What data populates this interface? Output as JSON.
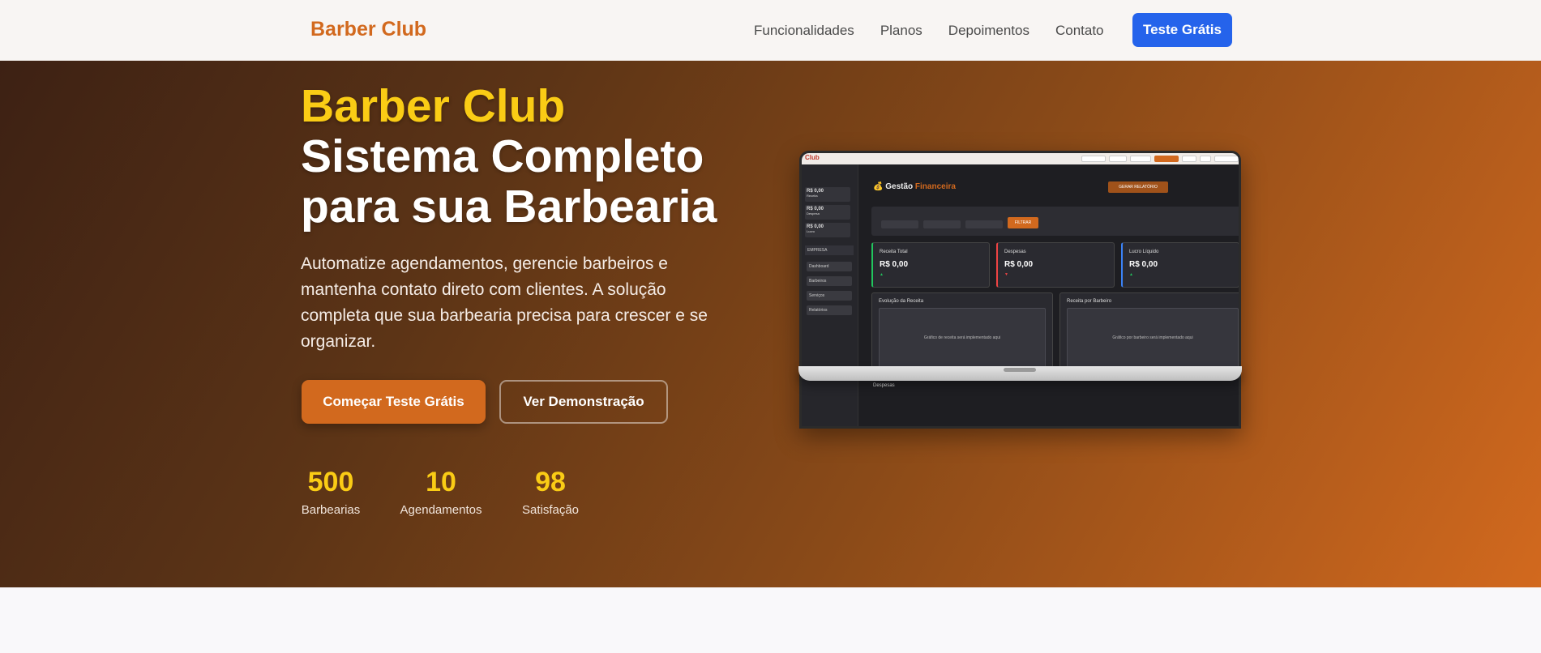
{
  "navbar": {
    "brand": "Barber Club",
    "links": [
      "Funcionalidades",
      "Planos",
      "Depoimentos",
      "Contato"
    ],
    "cta": "Teste Grátis"
  },
  "hero": {
    "title_line1": "Barber Club",
    "title_line2": "Sistema Completo para sua Barbearia",
    "description": "Automatize agendamentos, gerencie barbeiros e mantenha contato direto com clientes. A solução completa que sua barbearia precisa para crescer e se organizar.",
    "primary_button": "Começar Teste Grátis",
    "secondary_button": "Ver Demonstração",
    "stats": [
      {
        "value": "500",
        "label": "Barbearias"
      },
      {
        "value": "10",
        "label": "Agendamentos"
      },
      {
        "value": "98",
        "label": "Satisfação"
      }
    ]
  },
  "mockup": {
    "logo": "Club",
    "page_title_icon": "💰",
    "page_title_plain": "Gestão",
    "page_title_accent": "Financeira",
    "report_button": "GERAR RELATÓRIO",
    "filter_button": "FILTRAR",
    "sidebar_cards": [
      {
        "value": "R$ 0,00",
        "label": "Receita"
      },
      {
        "value": "R$ 0,00",
        "label": "Despesa"
      },
      {
        "value": "R$ 0,00",
        "label": "Lucro"
      }
    ],
    "sidebar_section": "EMPRESA",
    "sidebar_menu": [
      "Dashboard",
      "Barbeiros",
      "Serviços",
      "Relatórios"
    ],
    "kpis": [
      {
        "title": "Receita Total",
        "value": "R$ 0,00",
        "color": "#22c55e"
      },
      {
        "title": "Despesas",
        "value": "R$ 0,00",
        "color": "#ef4444"
      },
      {
        "title": "Lucro Líquido",
        "value": "R$ 0,00",
        "color": "#3b82f6"
      }
    ],
    "panels": [
      {
        "title": "Evolução da Receita",
        "body": "Gráfico de receita será implementado aqui"
      },
      {
        "title": "Receita por Barbeiro",
        "body": "Gráfico por barbeiro será implementado aqui"
      }
    ],
    "expenses_title": "Despesas"
  },
  "colors": {
    "brand": "#d2691e",
    "accent_yellow": "#facc15",
    "cta_blue": "#2563eb"
  }
}
